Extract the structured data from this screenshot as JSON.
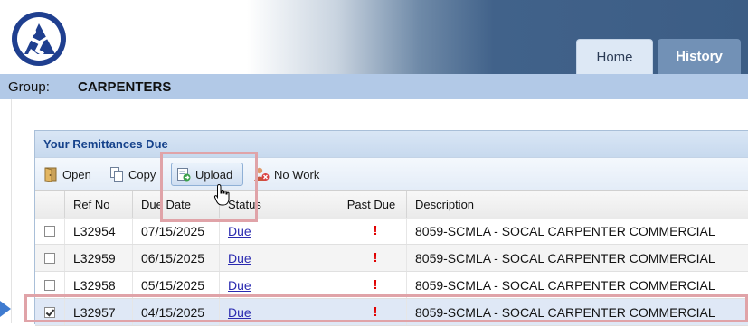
{
  "header": {
    "logo_icon": "worker-logo-icon",
    "tabs": [
      {
        "label": "Home",
        "active": true
      },
      {
        "label": "History",
        "active": false
      }
    ]
  },
  "group": {
    "label": "Group:",
    "value": "CARPENTERS"
  },
  "panel": {
    "title": "Your Remittances Due",
    "toolbar": {
      "open": {
        "label": "Open",
        "icon": "open-door-icon"
      },
      "copy": {
        "label": "Copy",
        "icon": "copy-icon"
      },
      "upload": {
        "label": "Upload",
        "icon": "upload-icon"
      },
      "no_work": {
        "label": "No Work",
        "icon": "no-work-icon"
      }
    },
    "columns": [
      "Ref No",
      "Due Date",
      "Status",
      "Past Due",
      "Description"
    ],
    "rows": [
      {
        "checked": false,
        "ref_no": "L32954",
        "due_date": "07/15/2025",
        "status": "Due",
        "past_due": "!",
        "description": "8059-SCMLA - SOCAL CARPENTER COMMERCIAL"
      },
      {
        "checked": false,
        "ref_no": "L32959",
        "due_date": "06/15/2025",
        "status": "Due",
        "past_due": "!",
        "description": "8059-SCMLA - SOCAL CARPENTER COMMERCIAL"
      },
      {
        "checked": false,
        "ref_no": "L32958",
        "due_date": "05/15/2025",
        "status": "Due",
        "past_due": "!",
        "description": "8059-SCMLA - SOCAL CARPENTER COMMERCIAL"
      },
      {
        "checked": true,
        "ref_no": "L32957",
        "due_date": "04/15/2025",
        "status": "Due",
        "past_due": "!",
        "description": "8059-SCMLA - SOCAL CARPENTER COMMERCIAL"
      }
    ]
  },
  "colors": {
    "accent": "#15428b",
    "group_bar": "#b2c9e7",
    "past_due": "#e00000",
    "highlight": "#e0a3a8",
    "pointer_arrow": "#3f7bd0"
  }
}
